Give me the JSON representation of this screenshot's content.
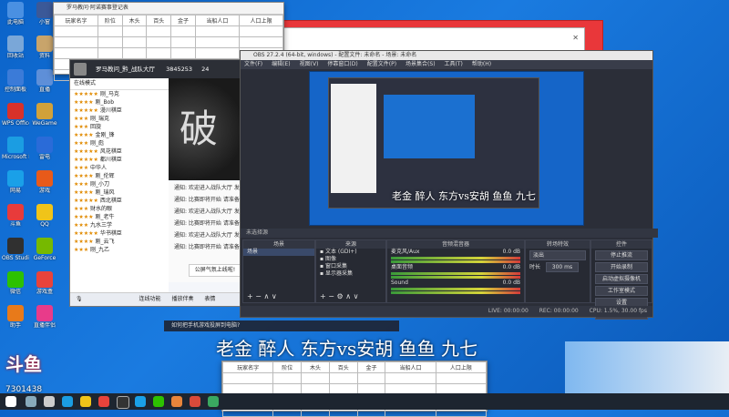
{
  "desktop_icons": [
    {
      "label": "此电脑",
      "color": "#4a90e2"
    },
    {
      "label": "小窗",
      "color": "#3b5998"
    },
    {
      "label": "回收站",
      "color": "#7aa7d8"
    },
    {
      "label": "资料",
      "color": "#c8a46b"
    },
    {
      "label": "控制面板",
      "color": "#3b7bd8"
    },
    {
      "label": "直播",
      "color": "#5e8fd8"
    },
    {
      "label": "WPS Office",
      "color": "#d8312a"
    },
    {
      "label": "WeGame",
      "color": "#d1a13a"
    },
    {
      "label": "Microsoft Edge",
      "color": "#1b9de2"
    },
    {
      "label": "雷电",
      "color": "#2a6bd8"
    },
    {
      "label": "网易",
      "color": "#1aa0e8"
    },
    {
      "label": "游戏",
      "color": "#e85a1a"
    },
    {
      "label": "斗鱼",
      "color": "#e83b3b"
    },
    {
      "label": "QQ",
      "color": "#f0c419"
    },
    {
      "label": "OBS Studio",
      "color": "#303030"
    },
    {
      "label": "GeForce",
      "color": "#76b900"
    },
    {
      "label": "微信",
      "color": "#2dc100"
    },
    {
      "label": "游戏盒",
      "color": "#e8433b"
    },
    {
      "label": "助手",
      "color": "#e87a1a"
    },
    {
      "label": "直播伴侣",
      "color": "#e83b8a"
    }
  ],
  "sheet_top": {
    "title": "罗马教问·阿诺赛事登记表",
    "headers": [
      "玩家名字",
      "阶位",
      "木头",
      "百头",
      "金子",
      "当船人口",
      "人口上限"
    ]
  },
  "sheet_bottom": {
    "headers": [
      "玩家名字",
      "阶位",
      "木头",
      "百头",
      "金子",
      "当船人口",
      "人口上限"
    ]
  },
  "chat": {
    "title": "罗马教问_黔_战队大厅",
    "count": "3845253",
    "online": "24",
    "banner_text": "破革",
    "tab": "在线模式",
    "users": [
      {
        "name": "刚_马克",
        "stars": "★★★★★"
      },
      {
        "name": "刚_Bob",
        "stars": "★★★★"
      },
      {
        "name": "漫川棋臣",
        "stars": "★★★★★"
      },
      {
        "name": "刚_瑞克",
        "stars": "★★★"
      },
      {
        "name": "回旋",
        "stars": "★★★"
      },
      {
        "name": "金刚_锋",
        "stars": "★★★★"
      },
      {
        "name": "刚_彪",
        "stars": "★★★"
      },
      {
        "name": "风花棋臣",
        "stars": "★★★★★"
      },
      {
        "name": "都川棋臣",
        "stars": "★★★★★"
      },
      {
        "name": "中华人",
        "stars": "★★★"
      },
      {
        "name": "刚_伦辉",
        "stars": "★★★★"
      },
      {
        "name": "刚_小刀",
        "stars": "★★★"
      },
      {
        "name": "刚_瑞风",
        "stars": "★★★★"
      },
      {
        "name": "西北棋臣",
        "stars": "★★★★★"
      },
      {
        "name": "财水的眼",
        "stars": "★★★"
      },
      {
        "name": "刚_老牛",
        "stars": "★★★★"
      },
      {
        "name": "九水三学",
        "stars": "★★★"
      },
      {
        "name": "华书棋臣",
        "stars": "★★★★★"
      },
      {
        "name": "刚_云飞",
        "stars": "★★★★"
      },
      {
        "name": "刚_九乙",
        "stars": "★★★"
      }
    ],
    "messages": [
      "通知: 欢迎进入战队大厅 发言请遵守规则",
      "通知: 比赛即将开始 请准备",
      "通知: 欢迎进入战队大厅 发言请遵守规则",
      "通知: 比赛即将开始 请准备",
      "通知: 欢迎进入战队大厅 发言请遵守规则",
      "通知: 比赛即将开始 请准备"
    ],
    "bottom_bar": [
      "连线功能",
      "播放伴奏",
      "表情"
    ],
    "popup": "公屏气氛上线啦!"
  },
  "obs": {
    "title": "OBS 27.2.4 (64-bit, windows) - 配置文件: 未命名 - 场景: 未命名",
    "menus": [
      "文件(F)",
      "编辑(E)",
      "视图(V)",
      "停靠窗口(D)",
      "配置文件(P)",
      "场景集合(S)",
      "工具(T)",
      "帮助(H)"
    ],
    "docks": {
      "scenes": {
        "title": "场景",
        "items": [
          "场景"
        ]
      },
      "sources": {
        "title": "来源",
        "items": [
          "文本 (GDI+)",
          "图像",
          "窗口采集",
          "显示器采集"
        ]
      },
      "mixer": {
        "title": "音频混音器",
        "channels": [
          {
            "name": "麦克风/Aux",
            "db": "0.0 dB"
          },
          {
            "name": "桌面音频",
            "db": "0.0 dB"
          },
          {
            "name": "Sound",
            "db": "0.0 dB"
          }
        ]
      },
      "transitions": {
        "title": "转场特效",
        "type": "淡出",
        "duration_label": "时长",
        "duration": "300 ms"
      },
      "controls": {
        "title": "控件",
        "buttons": [
          "停止推流",
          "开始录制",
          "启动虚拟摄像机",
          "工作室模式",
          "设置",
          "退出"
        ]
      }
    },
    "status": {
      "live": "LIVE: 00:00:00",
      "rec": "REC: 00:00:00",
      "cpu": "CPU: 1.5%, 30.00 fps",
      "sel": "未选择源"
    },
    "preview_caption": "老金 醉人 东方vs安胡 鱼鱼 九七"
  },
  "overlay_caption": "老金 醉人 东方vs安胡 鱼鱼 九七",
  "notice_bar": "如何把手机游戏投屏到电脑?",
  "douyu": {
    "logo": "斗鱼",
    "room": "7301438"
  }
}
